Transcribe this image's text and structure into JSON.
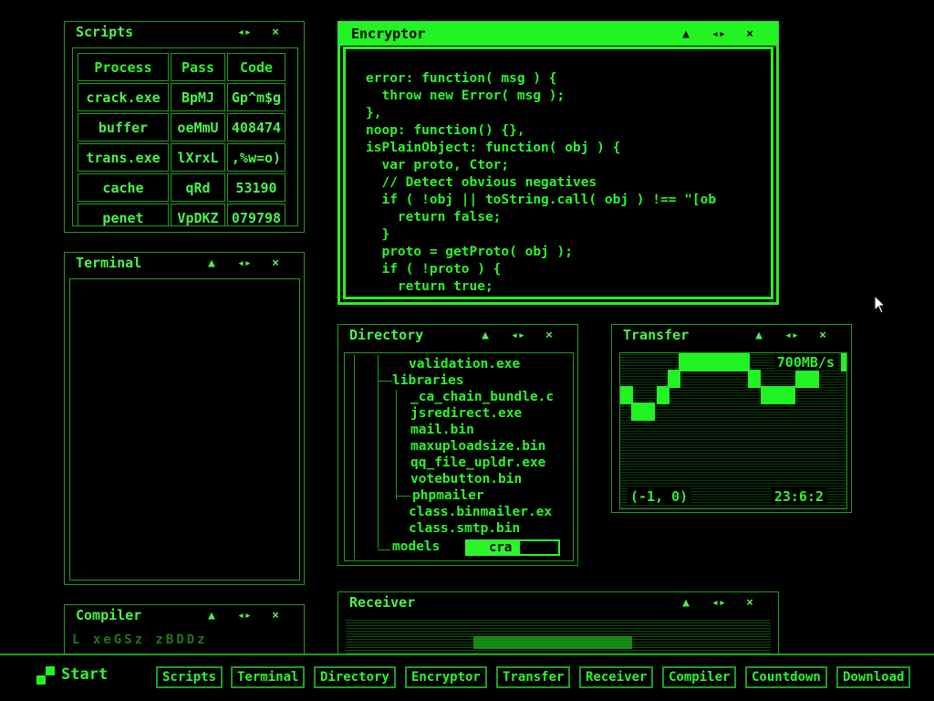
{
  "windows": {
    "scripts": {
      "title": "Scripts",
      "headers": [
        "Process",
        "Pass",
        "Code"
      ],
      "rows": [
        [
          "crack.exe",
          "BpMJ",
          "Gp^m$g"
        ],
        [
          "buffer",
          "oeMmU",
          "408474"
        ],
        [
          "trans.exe",
          "lXrxL",
          ",%w=o)"
        ],
        [
          "cache",
          "qRd",
          "53190"
        ],
        [
          "penet",
          "VpDKZ",
          "079798"
        ]
      ]
    },
    "terminal": {
      "title": "Terminal"
    },
    "encryptor": {
      "title": "Encryptor",
      "code": [
        "error: function( msg ) {",
        "  throw new Error( msg );",
        "},",
        "noop: function() {},",
        "isPlainObject: function( obj ) {",
        "  var proto, Ctor;",
        "  // Detect obvious negatives",
        "  if ( !obj || toString.call( obj ) !== \"[ob",
        "    return false;",
        "  }",
        "  proto = getProto( obj );",
        "  if ( !proto ) {",
        "    return true;",
        "  }"
      ]
    },
    "directory": {
      "title": "Directory",
      "items": [
        "validation.exe",
        "libraries",
        "_ca_chain_bundle.c",
        "jsredirect.exe",
        "mail.bin",
        "maxuploadsize.bin",
        "qq_file_upldr.exe",
        "votebutton.bin",
        "phpmailer",
        "class.binmailer.ex",
        "class.smtp.bin",
        "models"
      ],
      "input_value": "cra"
    },
    "transfer": {
      "title": "Transfer",
      "speed": "700MB/s",
      "coords": "(-1, 0)",
      "time": "23:6:2"
    },
    "receiver": {
      "title": "Receiver"
    },
    "compiler": {
      "title": "Compiler",
      "chars": "L xeGSz zBDDz"
    }
  },
  "taskbar": {
    "start_label": "Start",
    "buttons": [
      "Scripts",
      "Terminal",
      "Directory",
      "Encryptor",
      "Transfer",
      "Receiver",
      "Compiler",
      "Countdown",
      "Download"
    ]
  },
  "icons": {
    "minimize": "caret-up-icon",
    "resize": "horizontal-arrows-icon",
    "close": "close-icon"
  },
  "colors": {
    "accent": "#22f322",
    "dim": "#1f9d1f",
    "background": "#000000"
  }
}
